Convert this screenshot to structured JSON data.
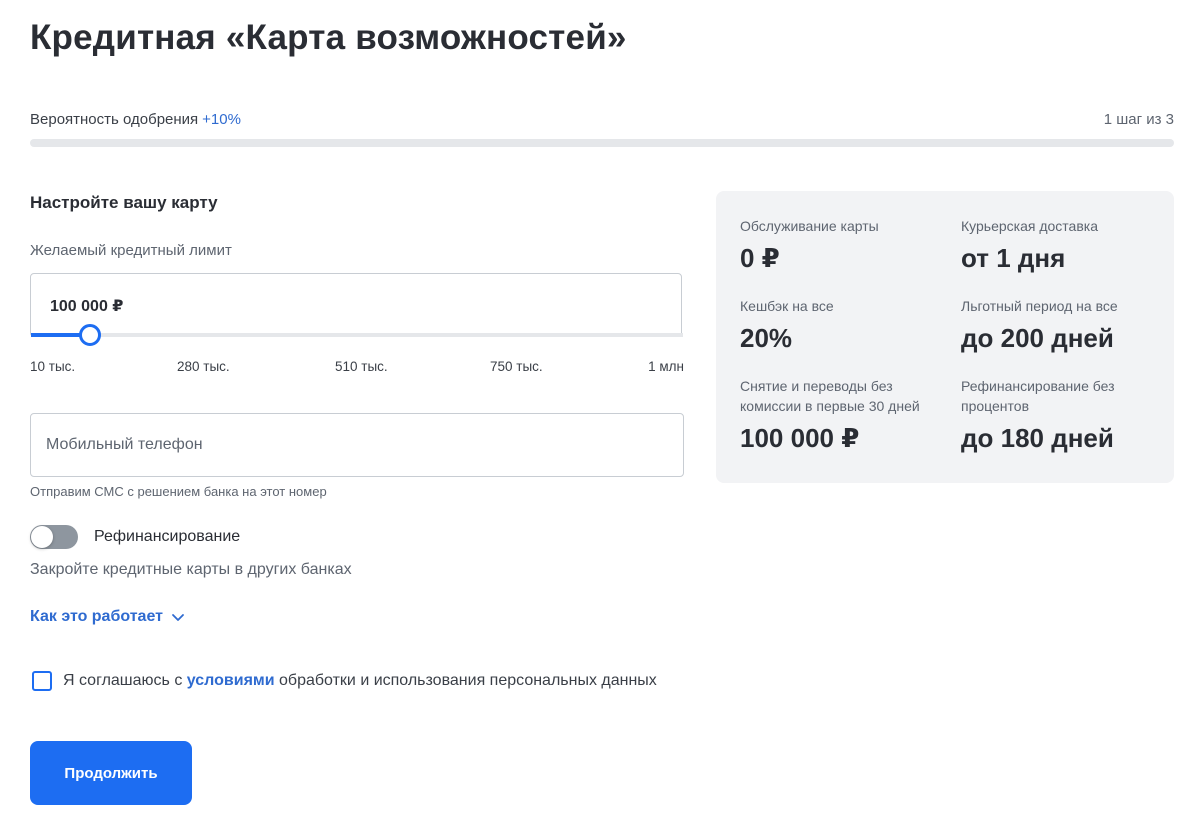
{
  "page": {
    "title": "Кредитная «Карта возможностей»"
  },
  "progress": {
    "approval_label": "Вероятность одобрения",
    "approval_value": "+10%",
    "step_label": "1 шаг из 3",
    "fill_fraction": 0
  },
  "form": {
    "section_title": "Настройте вашу карту",
    "limit_label": "Желаемый кредитный лимит",
    "limit_value": "100 000 ₽",
    "slider": {
      "min": 10000,
      "max": 1000000,
      "value": 100000,
      "ticks": [
        "10 тыс.",
        "280 тыс.",
        "510 тыс.",
        "750 тыс.",
        "1 млн"
      ]
    },
    "phone_placeholder": "Мобильный телефон",
    "phone_value": "",
    "phone_hint": "Отправим СМС с решением банка на этот номер",
    "refinance_label": "Рефинансирование",
    "refinance_on": false,
    "refinance_desc": "Закройте кредитные карты в других банках",
    "how_it_works": "Как это работает",
    "agree_prefix": "Я соглашаюсь с",
    "agree_link": "условиями",
    "agree_suffix": "обработки и использования персональных данных",
    "agree_checked": false,
    "continue_label": "Продолжить"
  },
  "info": [
    {
      "label": "Обслуживание карты",
      "value": "0 ₽"
    },
    {
      "label": "Курьерская доставка",
      "value": "от 1 дня"
    },
    {
      "label": "Кешбэк на все",
      "value": "20%"
    },
    {
      "label": "Льготный период на все",
      "value": "до 200 дней"
    },
    {
      "label": "Снятие и переводы без комиссии в первые 30 дней",
      "value": "100 000 ₽"
    },
    {
      "label": "Рефинансирование без процентов",
      "value": "до 180 дней"
    }
  ],
  "colors": {
    "accent": "#1d6df2",
    "link": "#2f6bd0",
    "panel_bg": "#f2f3f5",
    "toggle_off": "#8e969f"
  }
}
